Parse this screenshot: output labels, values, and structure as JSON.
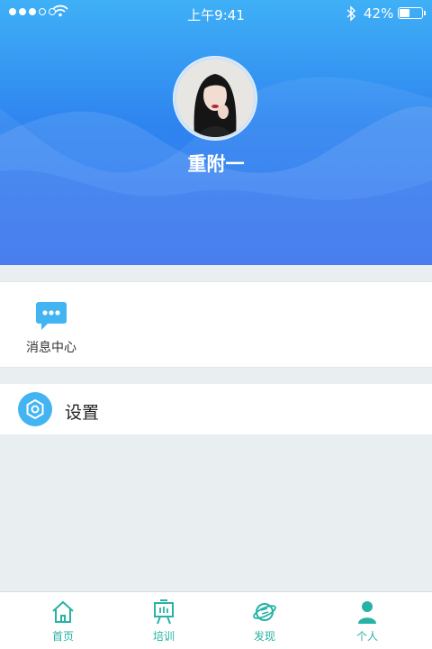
{
  "status_bar": {
    "time": "上午9:41",
    "battery": "42%",
    "battery_level": 0.42
  },
  "profile": {
    "name": "重附一",
    "avatar_icon": "user-photo"
  },
  "quick_actions": [
    {
      "label": "消息中心",
      "icon": "chat-bubble-icon"
    }
  ],
  "menu": {
    "settings_label": "设置",
    "settings_icon": "gear-icon"
  },
  "tabbar": {
    "items": [
      {
        "label": "首页",
        "icon": "home-icon"
      },
      {
        "label": "培训",
        "icon": "easel-icon"
      },
      {
        "label": "发现",
        "icon": "planet-icon"
      },
      {
        "label": "个人",
        "icon": "person-icon"
      }
    ],
    "active_index": 3
  },
  "colors": {
    "header_top": "#3fb0f6",
    "header_bottom": "#2f6ef0",
    "accent": "#43b4f2",
    "tab_color": "#26b3a5",
    "background": "#e9eef0"
  }
}
